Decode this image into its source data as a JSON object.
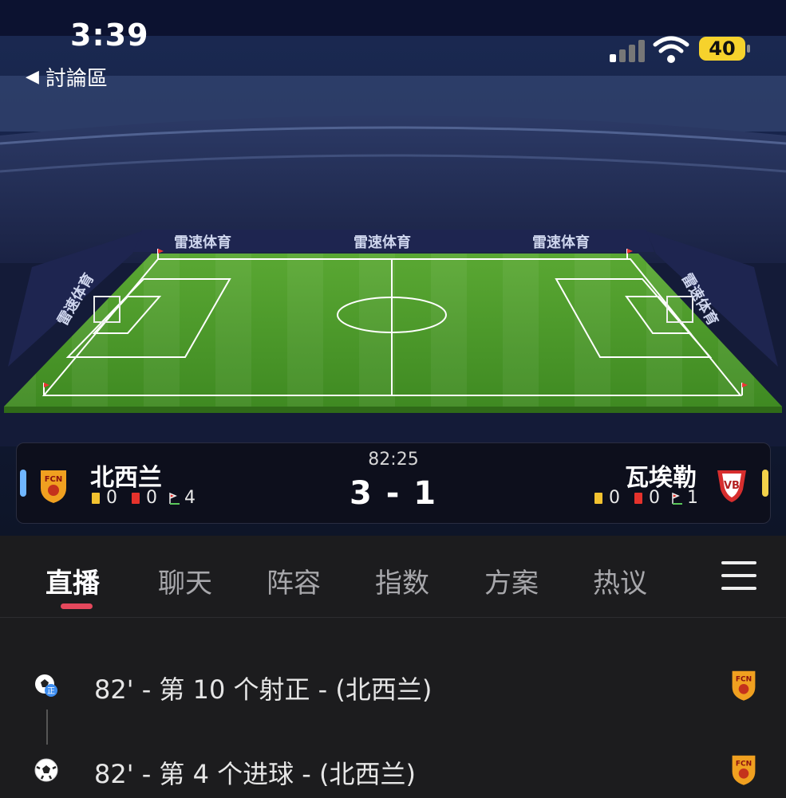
{
  "status_bar": {
    "time": "3:39",
    "back_label": "討論區",
    "battery": "40"
  },
  "stadium": {
    "ad_text": "雷速体育"
  },
  "match": {
    "clock": "82:25",
    "score": "3 - 1",
    "home": {
      "name": "北西兰",
      "yellow": "0",
      "red": "0",
      "corners": "4",
      "accent": "#6fb6ff"
    },
    "away": {
      "name": "瓦埃勒",
      "yellow": "0",
      "red": "0",
      "corners": "1",
      "accent": "#f3d24a"
    }
  },
  "tabs": [
    {
      "label": "直播",
      "active": true
    },
    {
      "label": "聊天"
    },
    {
      "label": "阵容"
    },
    {
      "label": "指数"
    },
    {
      "label": "方案"
    },
    {
      "label": "热议"
    }
  ],
  "events": [
    {
      "text": "82' - 第 10 个射正 - (北西兰)",
      "icon": "shot-on-target-icon"
    },
    {
      "text": "82' - 第 4 个进球 - (北西兰)",
      "icon": "goal-ball-icon"
    }
  ],
  "colors": {
    "tab_indicator": "#e5485c",
    "pitch": "#4f9a2c",
    "home_crest": "#f0a020"
  }
}
